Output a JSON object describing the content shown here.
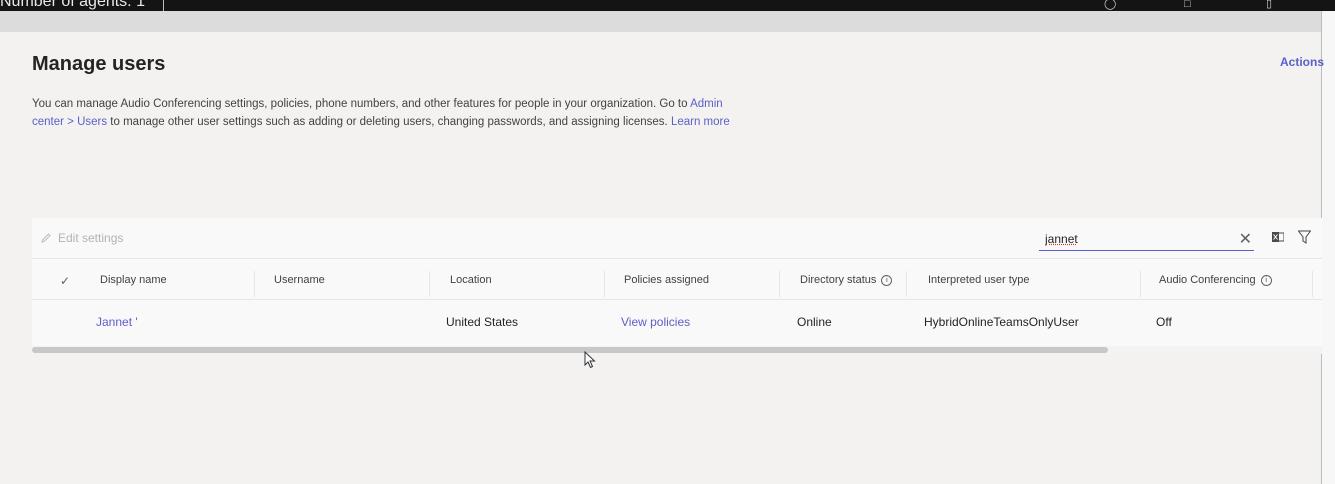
{
  "topbar": {
    "agents_text": "Number of agents: 1"
  },
  "page": {
    "title": "Manage users",
    "actions_label": "Actions",
    "description": {
      "text1": "You can manage Audio Conferencing settings, policies, phone numbers, and other features for people in your organization. Go to ",
      "admin_link": "Admin center > Users",
      "text2": " to manage other user settings such as adding or deleting users, changing passwords, and assigning licenses. ",
      "learn_more": "Learn more"
    }
  },
  "toolbar": {
    "edit_label": "Edit settings",
    "search_value": "jannet",
    "icons": {
      "edit": "pencil-icon",
      "clear": "close-icon",
      "export": "excel-icon",
      "filter": "filter-icon"
    }
  },
  "table": {
    "columns": {
      "display_name": "Display name",
      "username": "Username",
      "location": "Location",
      "policies": "Policies assigned",
      "directory_status": "Directory status",
      "user_type": "Interpreted user type",
      "audio_conf": "Audio Conferencing"
    },
    "rows": [
      {
        "display_name": "Jannet '",
        "username": "",
        "location": "United States",
        "policies": "View policies",
        "directory_status": "Online",
        "user_type": "HybridOnlineTeamsOnlyUser",
        "audio_conf": "Off"
      }
    ]
  },
  "colors": {
    "accent": "#5b5fc7",
    "background": "#f3f2f1",
    "panel": "#f9f9f9"
  }
}
